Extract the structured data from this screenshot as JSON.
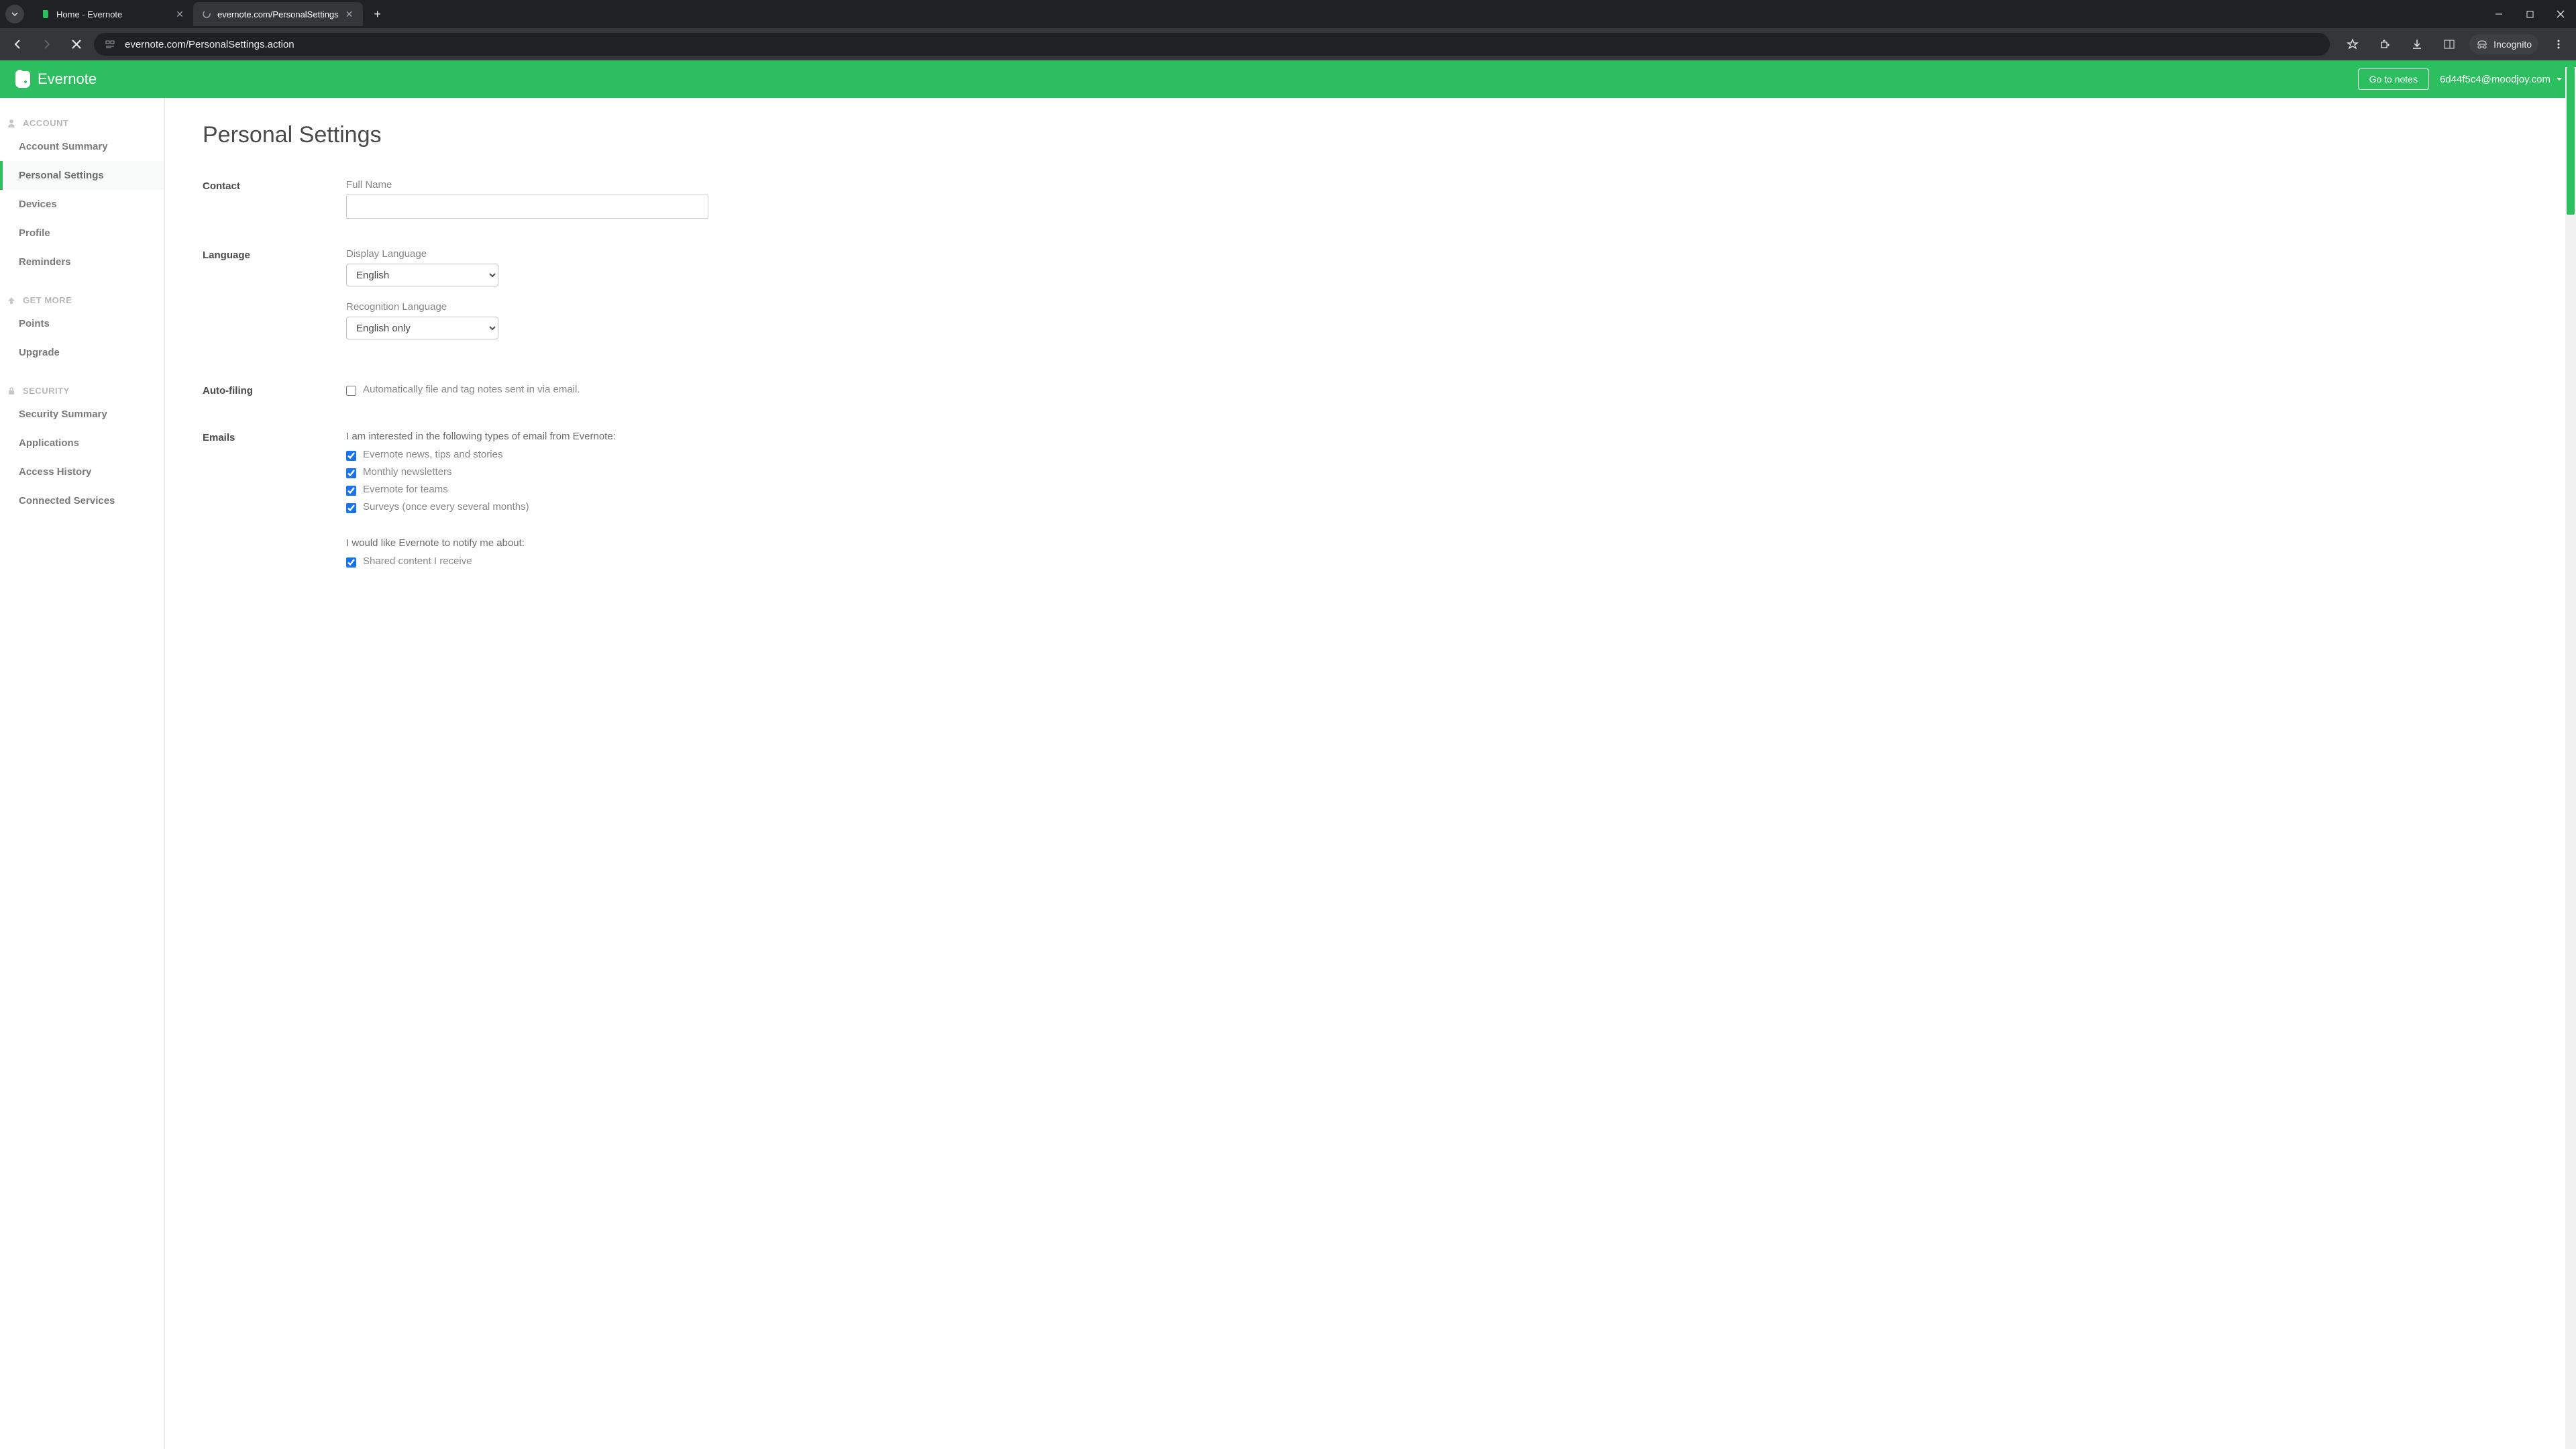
{
  "browser": {
    "tabs": [
      {
        "title": "Home - Evernote",
        "active": false
      },
      {
        "title": "evernote.com/PersonalSettings",
        "active": true
      }
    ],
    "url": "evernote.com/PersonalSettings.action",
    "incognito_label": "Incognito"
  },
  "header": {
    "brand": "Evernote",
    "go_to_notes": "Go to notes",
    "user_email": "6d44f5c4@moodjoy.com"
  },
  "sidebar": {
    "sections": [
      {
        "header": "ACCOUNT",
        "items": [
          "Account Summary",
          "Personal Settings",
          "Devices",
          "Profile",
          "Reminders"
        ]
      },
      {
        "header": "GET MORE",
        "items": [
          "Points",
          "Upgrade"
        ]
      },
      {
        "header": "SECURITY",
        "items": [
          "Security Summary",
          "Applications",
          "Access History",
          "Connected Services"
        ]
      }
    ],
    "active_item": "Personal Settings"
  },
  "main": {
    "title": "Personal Settings",
    "contact": {
      "label": "Contact",
      "full_name_label": "Full Name",
      "full_name_value": ""
    },
    "language": {
      "label": "Language",
      "display_label": "Display Language",
      "display_value": "English",
      "recognition_label": "Recognition Language",
      "recognition_value": "English only"
    },
    "auto_filing": {
      "label": "Auto-filing",
      "text": "Automatically file and tag notes sent in via email.",
      "checked": false
    },
    "emails": {
      "label": "Emails",
      "intro1": "I am interested in the following types of email from Evernote:",
      "opts1": [
        {
          "label": "Evernote news, tips and stories",
          "checked": true
        },
        {
          "label": "Monthly newsletters",
          "checked": true
        },
        {
          "label": "Evernote for teams",
          "checked": true
        },
        {
          "label": "Surveys (once every several months)",
          "checked": true
        }
      ],
      "intro2": "I would like Evernote to notify me about:",
      "opts2": [
        {
          "label": "Shared content I receive",
          "checked": true
        }
      ]
    }
  }
}
